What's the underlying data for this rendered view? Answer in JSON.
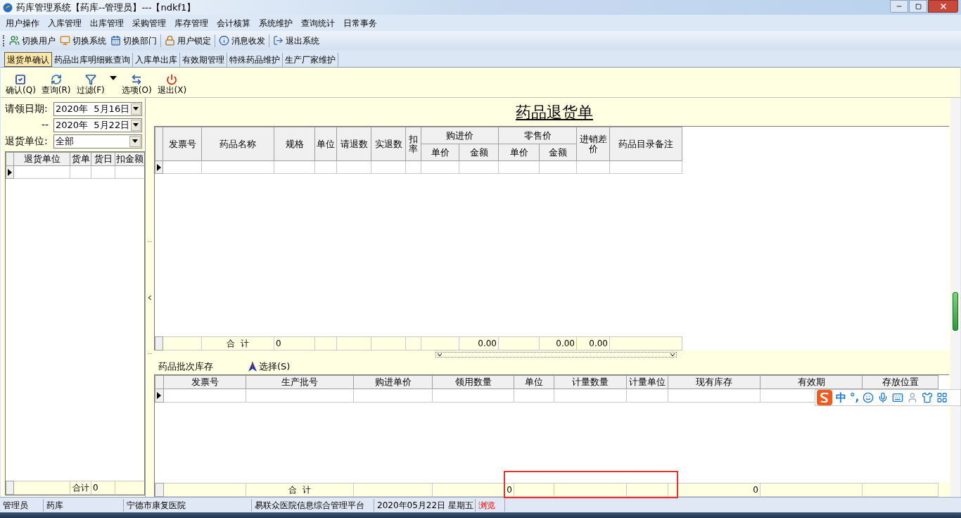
{
  "window": {
    "title": "药库管理系统【药库--管理员】---【ndkf1】"
  },
  "menu": [
    "用户操作",
    "入库管理",
    "出库管理",
    "采购管理",
    "库存管理",
    "会计核算",
    "系统维护",
    "查询统计",
    "日常事务"
  ],
  "toolbar": [
    {
      "label": "切换用户",
      "kind": "users"
    },
    {
      "label": "切换系统",
      "kind": "system"
    },
    {
      "label": "切换部门",
      "kind": "department"
    },
    {
      "label": "用户锁定",
      "kind": "lock"
    },
    {
      "label": "消息收发",
      "kind": "info"
    },
    {
      "label": "退出系统",
      "kind": "exit"
    }
  ],
  "tabs": [
    {
      "label": "退货单确认",
      "selected": true
    },
    {
      "label": "药品出库明细账查询",
      "selected": false
    },
    {
      "label": "入库单出库",
      "selected": false
    },
    {
      "label": "有效期管理",
      "selected": false
    },
    {
      "label": "特殊药品维护",
      "selected": false
    },
    {
      "label": "生产厂家维护",
      "selected": false
    }
  ],
  "actions": [
    {
      "label": "确认(Q)",
      "kind": "confirm"
    },
    {
      "label": "查询(R)",
      "kind": "query"
    },
    {
      "label": "过滤(F)",
      "kind": "filter"
    },
    {
      "kind": "dropdown"
    },
    {
      "label": "选项(O)",
      "kind": "options"
    },
    {
      "label": "退出(X)",
      "kind": "exit"
    }
  ],
  "filter": {
    "date_label": "请领日期:",
    "date_from": "2020年  5月16日",
    "range_sep": "--",
    "date_to": "2020年  5月22日",
    "unit_label": "退货单位:",
    "unit_value": "全部"
  },
  "left_table": {
    "columns": [
      {
        "label": "退货单位"
      },
      {
        "label": "货单",
        "total": "合计"
      },
      {
        "label": "货日",
        "total": "0"
      },
      {
        "label": "扣金额"
      }
    ]
  },
  "form": {
    "title": "药品退货单",
    "columns": [
      {
        "label": "发票号"
      },
      {
        "label": "药品名称",
        "total": "合  计"
      },
      {
        "label": "规格",
        "total": "0"
      },
      {
        "label": "单位"
      },
      {
        "label": "请退数"
      },
      {
        "label": "实退数"
      },
      {
        "label": "扣率"
      },
      {
        "label": "购进价",
        "children": [
          {
            "label": "单价"
          },
          {
            "label": "金额",
            "total": "0.00"
          }
        ]
      },
      {
        "label": "零售价",
        "children": [
          {
            "label": "单价"
          },
          {
            "label": "金额",
            "total": "0.00"
          }
        ]
      },
      {
        "label": "进销差价",
        "total": "0.00"
      },
      {
        "label": "药品目录备注"
      }
    ]
  },
  "batch": {
    "title": "药品批次库存",
    "select_button": "选择(S)",
    "columns": [
      {
        "label": "发票号"
      },
      {
        "label": "生产批号",
        "total": "合  计"
      },
      {
        "label": "购进单价"
      },
      {
        "label": "领用数量",
        "total": "0"
      },
      {
        "label": "单位"
      },
      {
        "label": "计量数量"
      },
      {
        "label": "计量单位"
      },
      {
        "label": "现有库存",
        "total": "0"
      },
      {
        "label": "有效期"
      },
      {
        "label": "存放位置"
      }
    ]
  },
  "ime": {
    "labels": [
      "中",
      "°,"
    ]
  },
  "status_bar": [
    {
      "text": "管理员",
      "kind": "text"
    },
    {
      "text": "药库",
      "kind": "text"
    },
    {
      "text": "宁德市康复医院",
      "kind": "text"
    },
    {
      "text": "易联众医院信息综合管理平台",
      "kind": "text"
    },
    {
      "text": "2020年05月22日 星期五",
      "kind": "text"
    },
    {
      "text": "浏览",
      "kind": "mode"
    }
  ]
}
